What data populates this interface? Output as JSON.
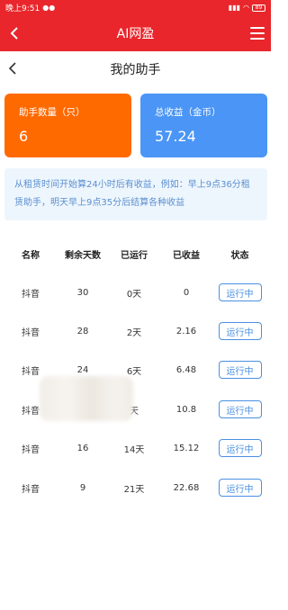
{
  "status_bar": {
    "time": "晚上9:51",
    "battery": "89"
  },
  "app_bar": {
    "title": "AI网盈"
  },
  "page": {
    "title": "我的助手"
  },
  "cards": {
    "assistant_count": {
      "label": "助手数量（只）",
      "value": "6",
      "color": "#ff6a00"
    },
    "total_earnings": {
      "label": "总收益（金币）",
      "value": "57.24",
      "color": "#4a95f5"
    }
  },
  "notice": {
    "text": "从租赁时间开始算24小时后有收益，例如：早上9点36分租赁助手，明天早上9点35分后结算各种收益"
  },
  "table": {
    "headers": [
      "名称",
      "剩余天数",
      "已运行",
      "已收益",
      "状态"
    ],
    "rows": [
      {
        "name": "抖音",
        "remaining_days": "30",
        "ran": "0天",
        "earned": "0",
        "status": "运行中"
      },
      {
        "name": "抖音",
        "remaining_days": "28",
        "ran": "2天",
        "earned": "2.16",
        "status": "运行中"
      },
      {
        "name": "抖音",
        "remaining_days": "24",
        "ran": "6天",
        "earned": "6.48",
        "status": "运行中"
      },
      {
        "name": "抖音",
        "remaining_days": "",
        "ran": "天",
        "earned": "10.8",
        "status": "运行中"
      },
      {
        "name": "抖音",
        "remaining_days": "16",
        "ran": "14天",
        "earned": "15.12",
        "status": "运行中"
      },
      {
        "name": "抖音",
        "remaining_days": "9",
        "ran": "21天",
        "earned": "22.68",
        "status": "运行中"
      }
    ]
  },
  "colors": {
    "primary_red": "#e8262b",
    "accent_blue": "#4a90e2",
    "notice_text": "#5a8fd0"
  }
}
